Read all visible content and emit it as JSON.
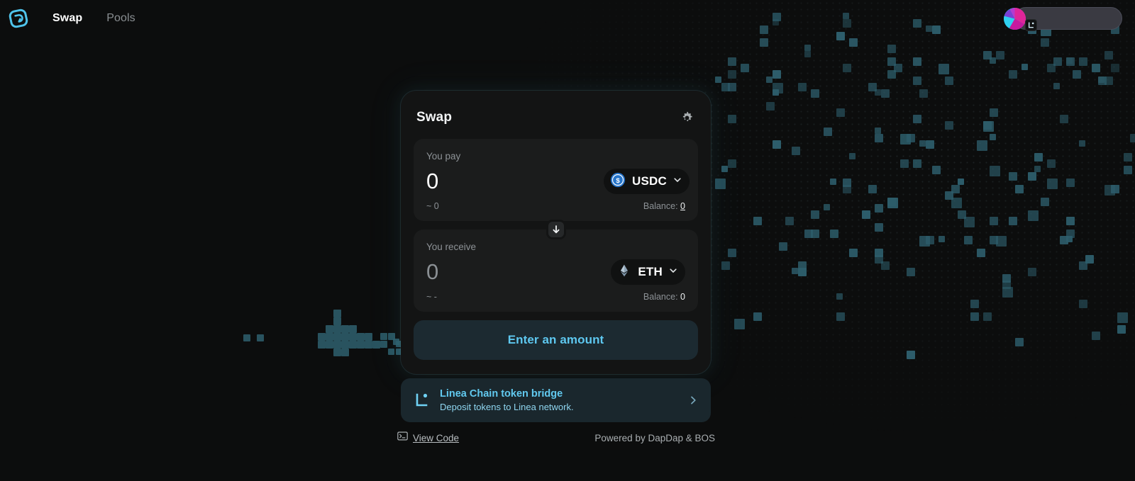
{
  "nav": {
    "logo_icon": "dapdap-logo-icon",
    "links": [
      {
        "label": "Swap",
        "active": true
      },
      {
        "label": "Pools",
        "active": false
      }
    ]
  },
  "wallet": {
    "address": "",
    "avatar_icon": "wallet-avatar-icon",
    "badge_icon": "linea-badge-icon"
  },
  "swap_card": {
    "title": "Swap",
    "settings_icon": "gear-icon",
    "switch_icon": "arrow-down-icon",
    "pay": {
      "label": "You pay",
      "amount": "0",
      "placeholder": "0",
      "approx": "~ 0",
      "balance_label": "Balance:",
      "balance_value": "0",
      "token": "USDC",
      "token_icon": "usdc-icon",
      "chevron_icon": "chevron-down-icon"
    },
    "receive": {
      "label": "You receive",
      "amount": "0",
      "placeholder": "0",
      "approx": "~ -",
      "balance_label": "Balance:",
      "balance_value": "0",
      "token": "ETH",
      "token_icon": "eth-icon",
      "chevron_icon": "chevron-down-icon"
    },
    "action_label": "Enter an amount"
  },
  "bridge": {
    "title": "Linea Chain token bridge",
    "subtitle": "Deposit tokens to Linea network.",
    "logo_icon": "linea-logo-icon",
    "chevron_icon": "chevron-right-icon"
  },
  "footer": {
    "view_code_label": "View Code",
    "view_code_icon": "terminal-icon",
    "powered_by": "Powered by DapDap & BOS"
  },
  "colors": {
    "accent": "#5ec8f0",
    "background": "#0c0d0d",
    "card": "#131414",
    "panel": "#1b1c1c",
    "pixel": "#2d5d6b",
    "bridge_bg": "#1a272d"
  }
}
